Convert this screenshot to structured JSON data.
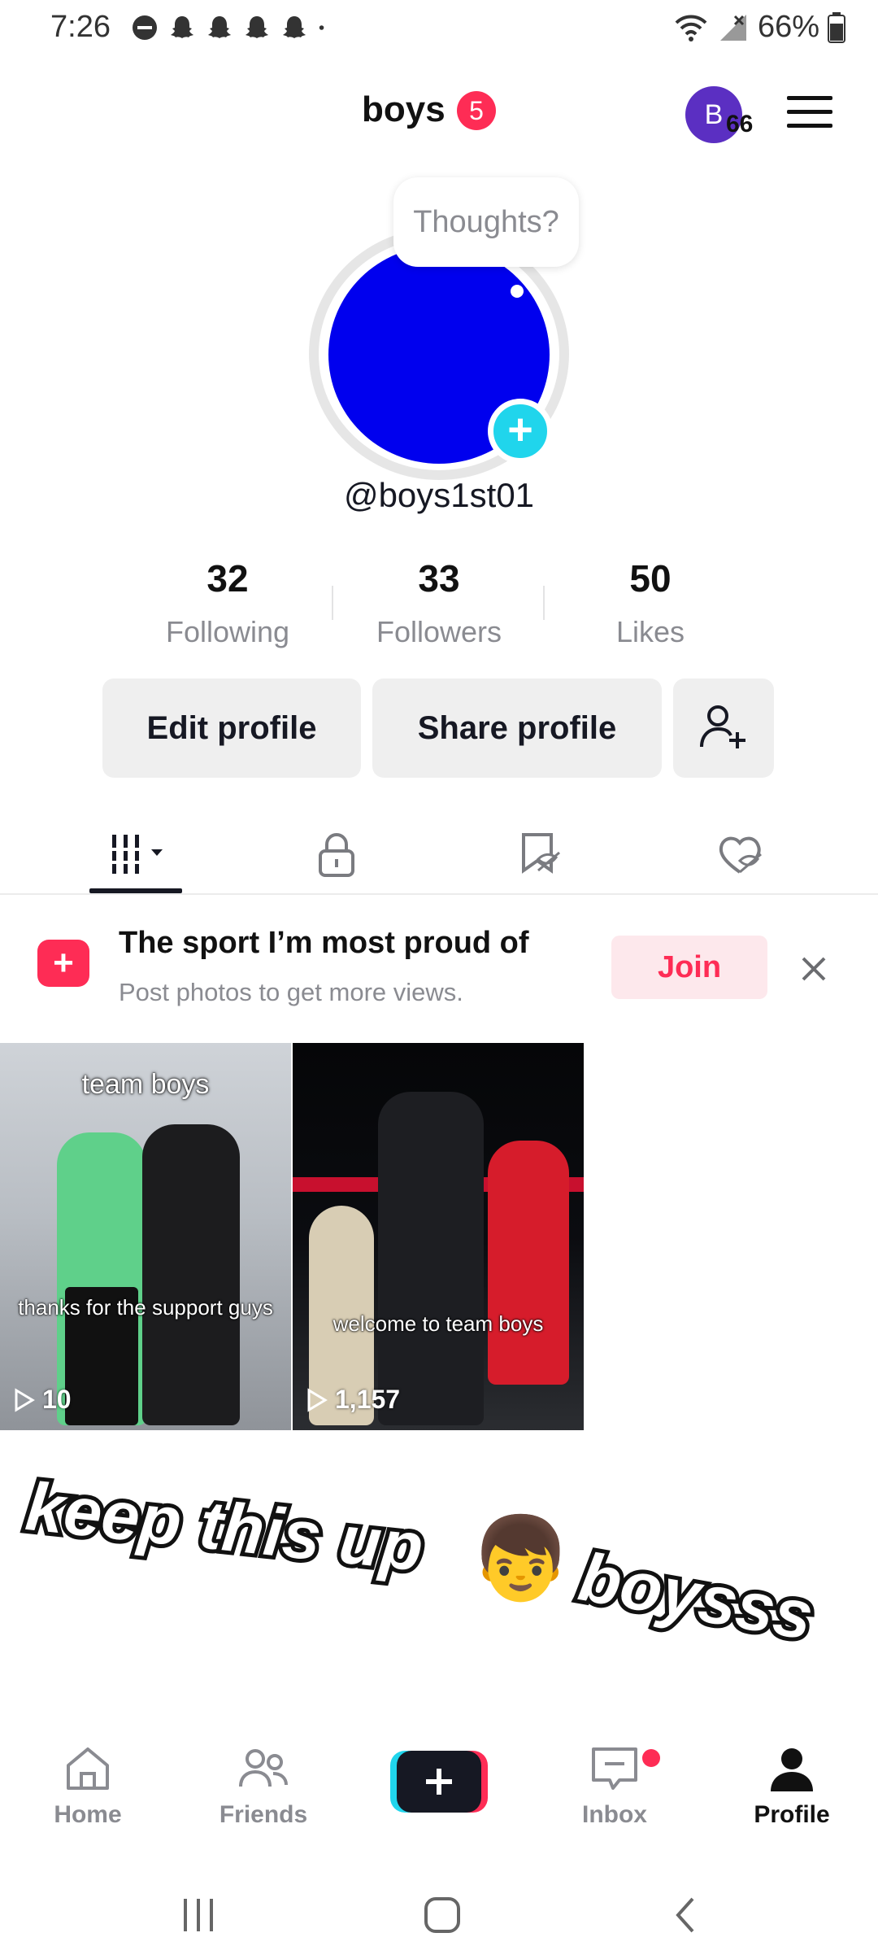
{
  "status_bar": {
    "time": "7:26",
    "battery": "66%",
    "left_icons": [
      "dnd-icon",
      "snapchat-icon",
      "snapchat-icon",
      "snapchat-icon",
      "snapchat-icon",
      "dot-icon"
    ],
    "right_icons": [
      "wifi-icon",
      "signal-icon",
      "battery-icon"
    ]
  },
  "header": {
    "title": "boys",
    "badge_count": "5",
    "avatar_letter": "B",
    "avatar_count": "66"
  },
  "profile": {
    "thought_placeholder": "Thoughts?",
    "handle": "@boys1st01",
    "photo_color": "#0000ee"
  },
  "stats": [
    {
      "value": "32",
      "label": "Following"
    },
    {
      "value": "33",
      "label": "Followers"
    },
    {
      "value": "50",
      "label": "Likes"
    }
  ],
  "buttons": {
    "edit_profile": "Edit profile",
    "share_profile": "Share profile"
  },
  "tabs": [
    {
      "icon": "grid-sort-icon",
      "active": true
    },
    {
      "icon": "lock-icon",
      "active": false
    },
    {
      "icon": "bookmark-hidden-icon",
      "active": false
    },
    {
      "icon": "heart-hidden-icon",
      "active": false
    }
  ],
  "promo": {
    "title": "The sport I’m most proud of",
    "subtitle": "Post photos to get more views.",
    "join_label": "Join"
  },
  "videos": [
    {
      "caption_top": "team boys",
      "caption_mid": "thanks for the support guys",
      "views": "10"
    },
    {
      "caption_top": "",
      "caption_mid": "welcome to team boys",
      "views": "1,157"
    }
  ],
  "sticker": {
    "text_left": "keep this up",
    "text_right": "boysss",
    "emoji": "👦"
  },
  "bottom_nav": [
    {
      "label": "Home",
      "icon": "home-icon"
    },
    {
      "label": "Friends",
      "icon": "friends-icon"
    },
    {
      "label": "",
      "icon": "create-plus-icon"
    },
    {
      "label": "Inbox",
      "icon": "inbox-icon"
    },
    {
      "label": "Profile",
      "icon": "profile-icon"
    }
  ],
  "colors": {
    "accent": "#fe2c55",
    "teal": "#20d5ec",
    "text_primary": "#161823",
    "text_secondary": "#8a8b91"
  }
}
